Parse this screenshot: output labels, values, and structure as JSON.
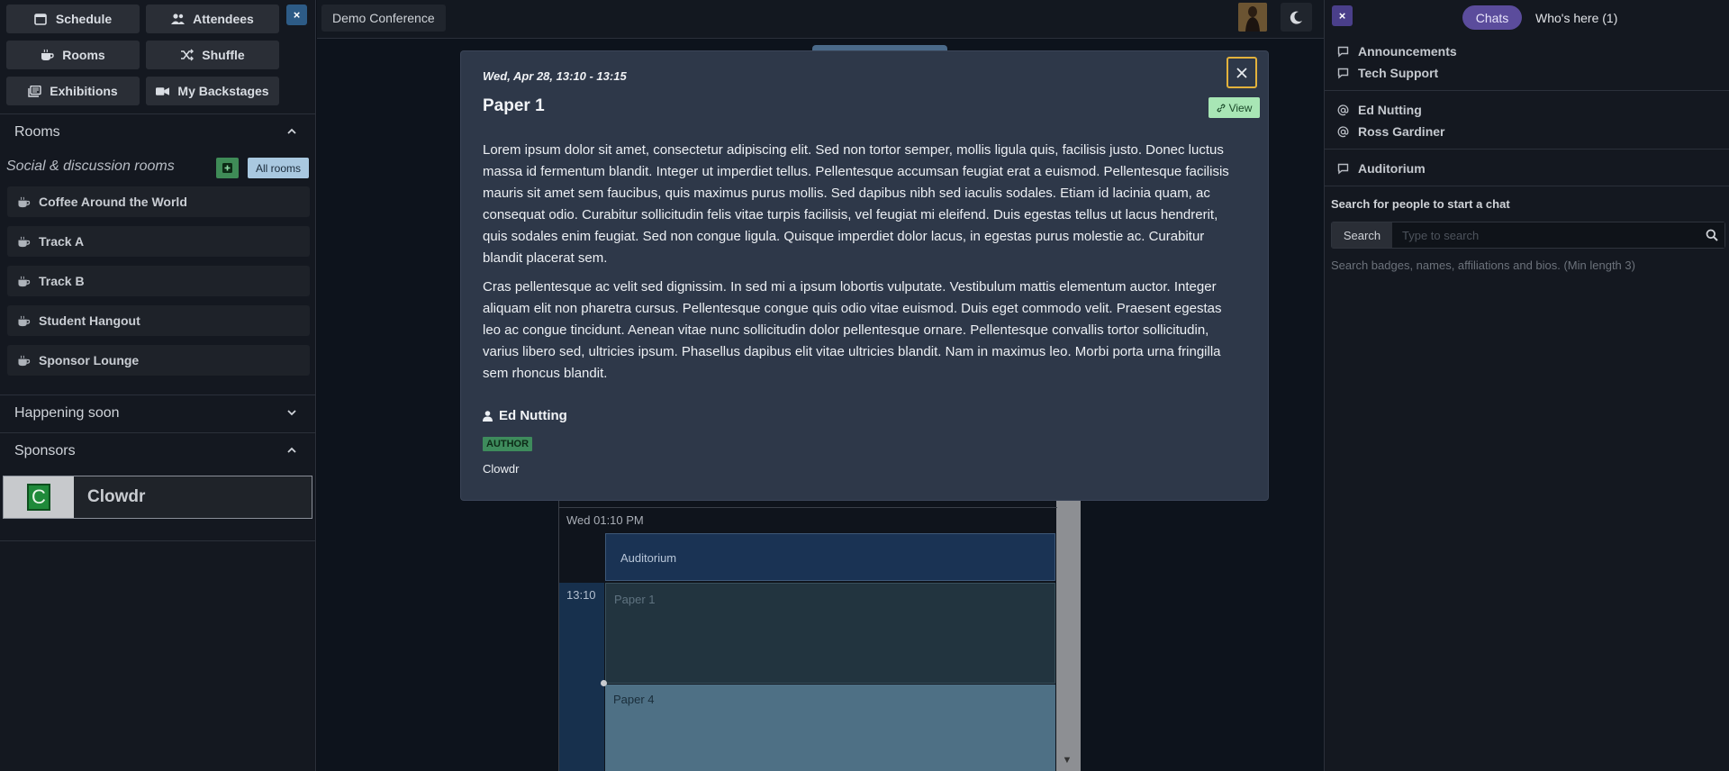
{
  "left_nav": {
    "schedule": "Schedule",
    "attendees": "Attendees",
    "rooms": "Rooms",
    "shuffle": "Shuffle",
    "exhibitions": "Exhibitions",
    "my_backstages": "My Backstages",
    "close": "×"
  },
  "rooms_section": {
    "title": "Rooms",
    "subtitle": "Social & discussion rooms",
    "all_rooms": "All rooms",
    "items": [
      {
        "label": "Coffee Around the World"
      },
      {
        "label": "Track A"
      },
      {
        "label": "Track B"
      },
      {
        "label": "Student Hangout"
      },
      {
        "label": "Sponsor Lounge"
      }
    ]
  },
  "happening_soon": {
    "title": "Happening soon"
  },
  "sponsors": {
    "title": "Sponsors",
    "items": [
      {
        "logo_letter": "C",
        "name": "Clowdr"
      }
    ]
  },
  "topbar": {
    "conference": "Demo Conference"
  },
  "schedule": {
    "time_header": "Wed 01:10 PM",
    "room": "Auditorium",
    "time": "13:10",
    "events": [
      "Paper 1",
      "Paper 4"
    ]
  },
  "modal": {
    "date": "Wed, Apr 28, 13:10 - 13:15",
    "title": "Paper 1",
    "view_label": "View",
    "paragraphs": [
      "Lorem ipsum dolor sit amet, consectetur adipiscing elit. Sed non tortor semper, mollis ligula quis, facilisis justo. Donec luctus massa id fermentum blandit. Integer ut imperdiet tellus. Pellentesque accumsan feugiat erat a euismod. Pellentesque facilisis mauris sit amet sem faucibus, quis maximus purus mollis. Sed dapibus nibh sed iaculis sodales. Etiam id lacinia quam, ac consequat odio. Curabitur sollicitudin felis vitae turpis facilisis, vel feugiat mi eleifend. Duis egestas tellus ut lacus hendrerit, quis sodales enim feugiat. Sed non congue ligula. Quisque imperdiet dolor lacus, in egestas purus molestie ac. Curabitur blandit placerat sem.",
      "Cras pellentesque ac velit sed dignissim. In sed mi a ipsum lobortis vulputate. Vestibulum mattis elementum auctor. Integer aliquam elit non pharetra cursus. Pellentesque congue quis odio vitae euismod. Duis eget commodo velit. Praesent egestas leo ac congue tincidunt. Aenean vitae nunc sollicitudin dolor pellentesque ornare. Pellentesque convallis tortor sollicitudin, varius libero sed, ultricies ipsum. Phasellus dapibus elit vitae ultricies blandit. Nam in maximus leo. Morbi porta urna fringilla sem rhoncus blandit."
    ],
    "author_name": "Ed Nutting",
    "author_role": "AUTHOR",
    "author_affiliation": "Clowdr"
  },
  "right_panel": {
    "close": "×",
    "tabs": {
      "chats": "Chats",
      "whos_here": "Who's here (1)"
    },
    "channels": [
      "Announcements",
      "Tech Support"
    ],
    "dms": [
      "Ed Nutting",
      "Ross Gardiner"
    ],
    "rooms": [
      "Auditorium"
    ],
    "search_label": "Search for people to start a chat",
    "search_button": "Search",
    "search_placeholder": "Type to search",
    "search_hint": "Search badges, names, affiliations and bios. (Min length 3)"
  },
  "colors": {
    "accent_blue": "#2d5b86",
    "chats_tab": "#5b4c9c",
    "view_button": "#a8e6b5",
    "close_highlight": "#e3b23c",
    "author_badge": "#3e8b5c"
  }
}
